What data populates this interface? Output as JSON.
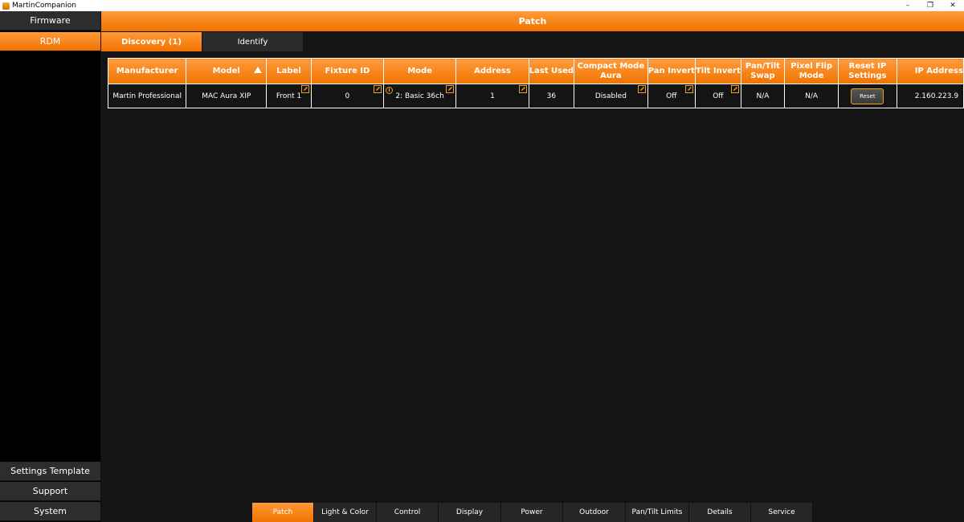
{
  "window": {
    "title": "MartinCompanion",
    "minimize": "–",
    "maximize": "❐",
    "close": "✕"
  },
  "sidebar": {
    "top_items": [
      {
        "label": "Firmware",
        "active": false
      },
      {
        "label": "RDM",
        "active": true
      }
    ],
    "bottom_items": [
      {
        "label": "Settings Template"
      },
      {
        "label": "Support"
      },
      {
        "label": "System"
      }
    ]
  },
  "main": {
    "title": "Patch",
    "subtabs": [
      {
        "label": "Discovery (1)",
        "active": true
      },
      {
        "label": "Identify",
        "active": false
      }
    ]
  },
  "table": {
    "headers": [
      {
        "label": "Manufacturer"
      },
      {
        "label": "Model",
        "sorted": "ascending"
      },
      {
        "label": "Label"
      },
      {
        "label": "Fixture ID"
      },
      {
        "label": "Mode"
      },
      {
        "label": "Address"
      },
      {
        "label": "Last Used"
      },
      {
        "label": "Compact Mode Aura"
      },
      {
        "label": "Pan Invert"
      },
      {
        "label": "Tilt Invert"
      },
      {
        "label": "Pan/Tilt Swap"
      },
      {
        "label": "Pixel Flip Mode"
      },
      {
        "label": "Reset IP Settings"
      },
      {
        "label": "IP Address"
      }
    ],
    "rows": [
      {
        "manufacturer": "Martin Professional",
        "model": "MAC Aura XIP",
        "label": "Front 1",
        "fixture_id": "0",
        "mode": "2: Basic 36ch",
        "address": "1",
        "last_used": "36",
        "compact_mode": "Disabled",
        "pan_invert": "Off",
        "tilt_invert": "Off",
        "pan_tilt_swap": "N/A",
        "pixel_flip": "N/A",
        "reset_label": "Reset",
        "ip_address": "2.160.223.9"
      }
    ]
  },
  "bottom_tabs": [
    {
      "label": "Patch",
      "active": true
    },
    {
      "label": "Light & Color"
    },
    {
      "label": "Control"
    },
    {
      "label": "Display"
    },
    {
      "label": "Power"
    },
    {
      "label": "Outdoor"
    },
    {
      "label": "Pan/Tilt Limits"
    },
    {
      "label": "Details"
    },
    {
      "label": "Service"
    }
  ],
  "colors": {
    "accent": "#f07300",
    "accent_light": "#ff9a3a",
    "background": "#141414",
    "edit_icon": "#f0a020"
  },
  "icons": {
    "edit": "edit-pencil-icon",
    "info": "info-icon",
    "sort": "sort-ascending-icon"
  }
}
